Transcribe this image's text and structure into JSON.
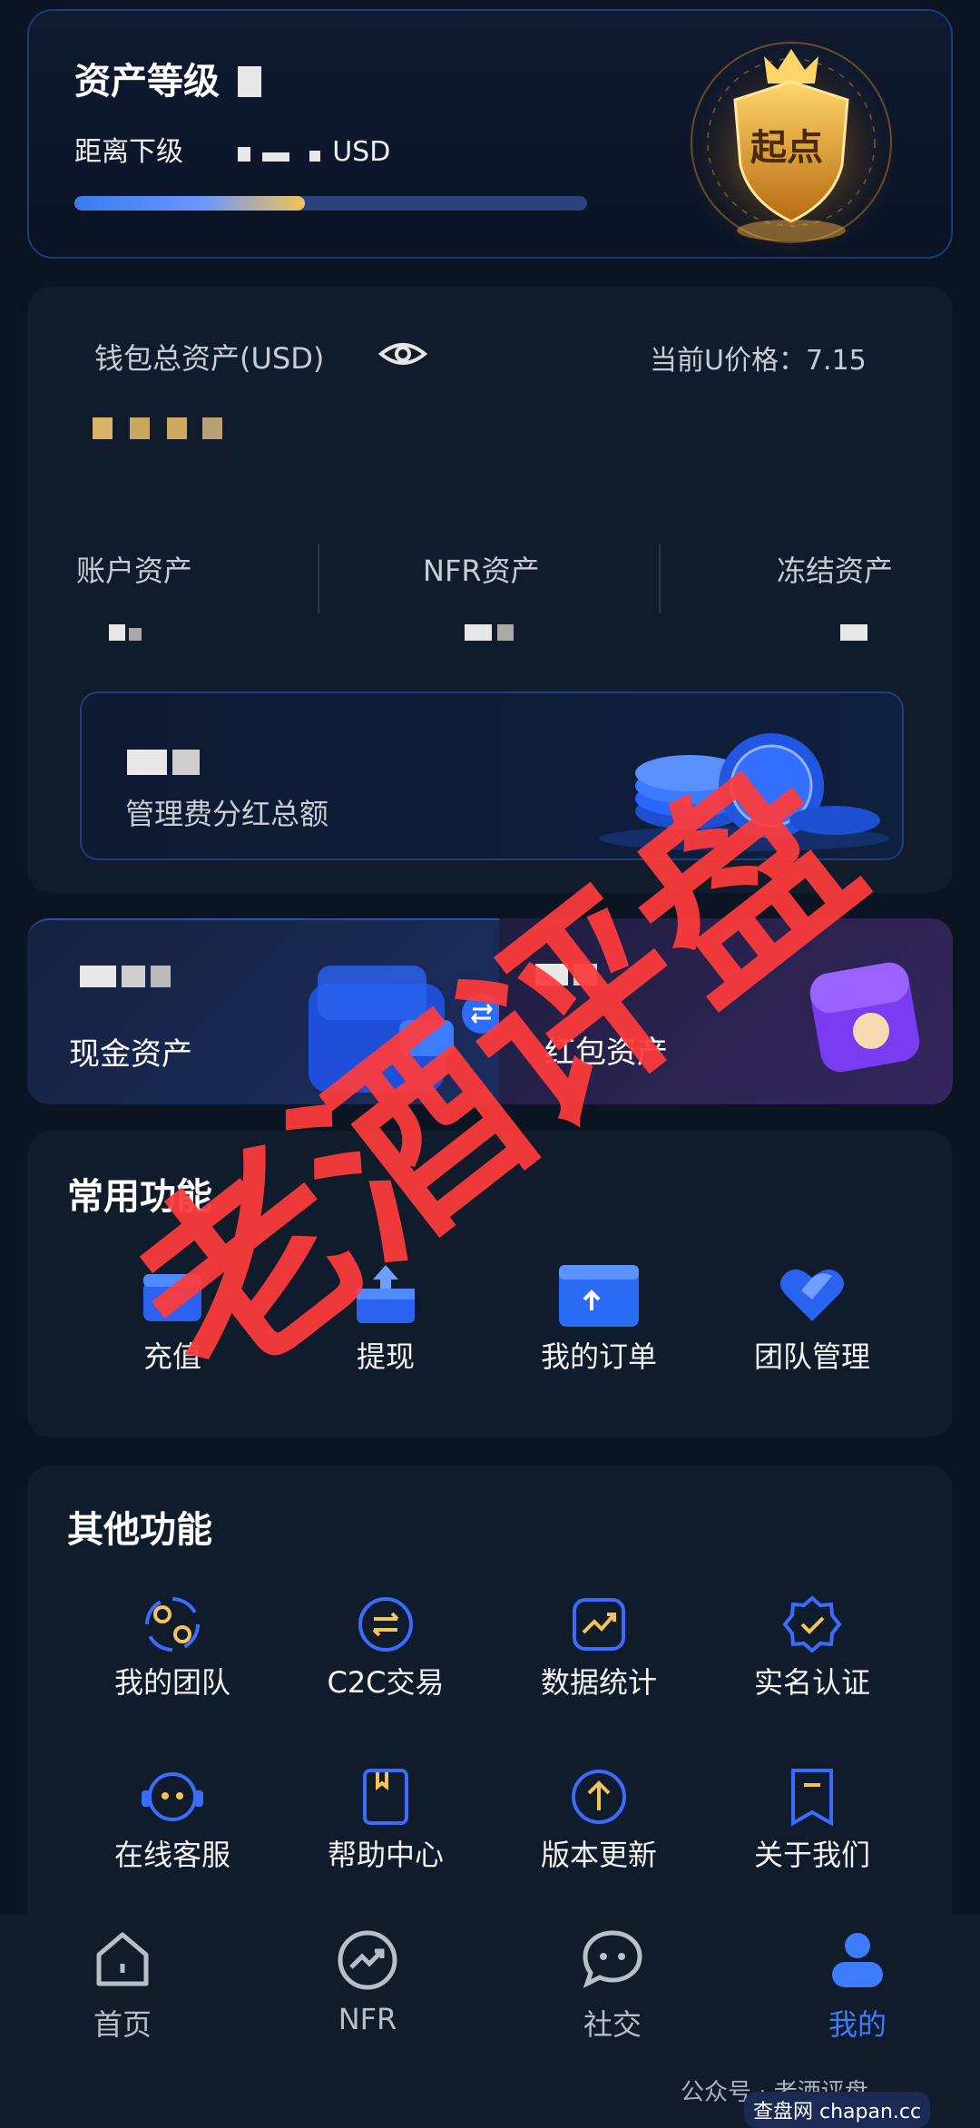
{
  "level": {
    "title": "资产等级",
    "next_prefix": "距离下级",
    "next_suffix": "USD",
    "progress": 0.45,
    "badge_text": "起点"
  },
  "wallet": {
    "total_label": "钱包总资产(USD)",
    "price_label": "当前U价格：7.15",
    "account_label": "账户资产",
    "nfr_label": "NFR资产",
    "frozen_label": "冻结资产",
    "fee_label": "管理费分红总额"
  },
  "cash": {
    "label": "现金资产"
  },
  "red_packet": {
    "label": "红包资产"
  },
  "common": {
    "title": "常用功能",
    "items": [
      {
        "label": "充值",
        "icon": "deposit-icon"
      },
      {
        "label": "提现",
        "icon": "withdraw-icon"
      },
      {
        "label": "我的订单",
        "icon": "order-icon"
      },
      {
        "label": "团队管理",
        "icon": "team-manage-icon"
      }
    ]
  },
  "other": {
    "title": "其他功能",
    "items": [
      {
        "label": "我的团队",
        "icon": "team-icon"
      },
      {
        "label": "C2C交易",
        "icon": "exchange-icon"
      },
      {
        "label": "数据统计",
        "icon": "chart-icon"
      },
      {
        "label": "实名认证",
        "icon": "verify-icon"
      },
      {
        "label": "在线客服",
        "icon": "support-icon"
      },
      {
        "label": "帮助中心",
        "icon": "help-icon"
      },
      {
        "label": "版本更新",
        "icon": "update-icon"
      },
      {
        "label": "关于我们",
        "icon": "about-icon"
      }
    ]
  },
  "nav": {
    "items": [
      {
        "label": "首页",
        "icon": "home-icon"
      },
      {
        "label": "NFR",
        "icon": "nfr-icon"
      },
      {
        "label": "社交",
        "icon": "chat-icon"
      },
      {
        "label": "我的",
        "icon": "profile-icon"
      }
    ]
  },
  "watermark": {
    "text": "老酒评盘"
  },
  "footer": {
    "account": "公众号 · 老酒评盘",
    "site": "查盘网 chapan.cc"
  },
  "colors": {
    "accent": "#3d7cff",
    "gold": "#f3c458",
    "watermark": "#ff3b3b"
  }
}
